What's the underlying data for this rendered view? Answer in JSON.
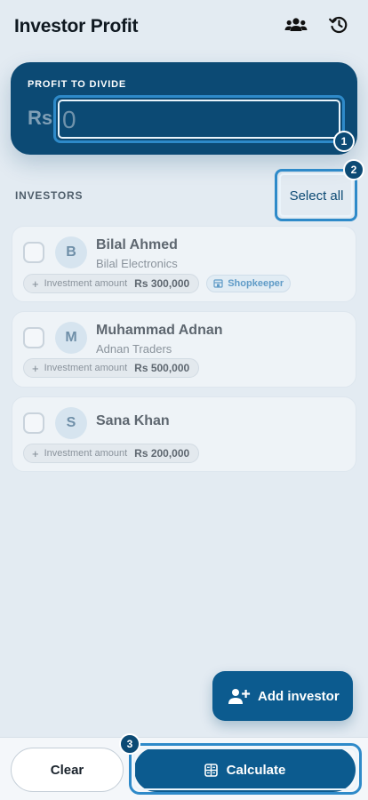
{
  "header": {
    "title": "Investor Profit",
    "icons": [
      "group-icon",
      "history-icon"
    ]
  },
  "profit": {
    "label": "PROFIT TO DIVIDE",
    "currency_prefix": "Rs",
    "value": "",
    "placeholder": "0"
  },
  "investors_section": {
    "label": "INVESTORS",
    "select_all_label": "Select all"
  },
  "investors": [
    {
      "initial": "B",
      "name": "Bilal Ahmed",
      "company": "Bilal Electronics",
      "investment_label": "Investment amount",
      "amount": "Rs 300,000",
      "role": "Shopkeeper",
      "checked": false
    },
    {
      "initial": "M",
      "name": "Muhammad Adnan",
      "company": "Adnan Traders",
      "investment_label": "Investment amount",
      "amount": "Rs 500,000",
      "checked": false
    },
    {
      "initial": "S",
      "name": "Sana Khan",
      "company": "",
      "investment_label": "Investment amount",
      "amount": "Rs 200,000",
      "checked": false
    }
  ],
  "fab": {
    "label": "Add investor"
  },
  "footer": {
    "clear_label": "Clear",
    "calculate_label": "Calculate"
  },
  "markers": [
    "1",
    "2",
    "3"
  ],
  "colors": {
    "primary": "#0c4a74",
    "accent": "#0c5b8f",
    "background": "#e3ebf2"
  }
}
